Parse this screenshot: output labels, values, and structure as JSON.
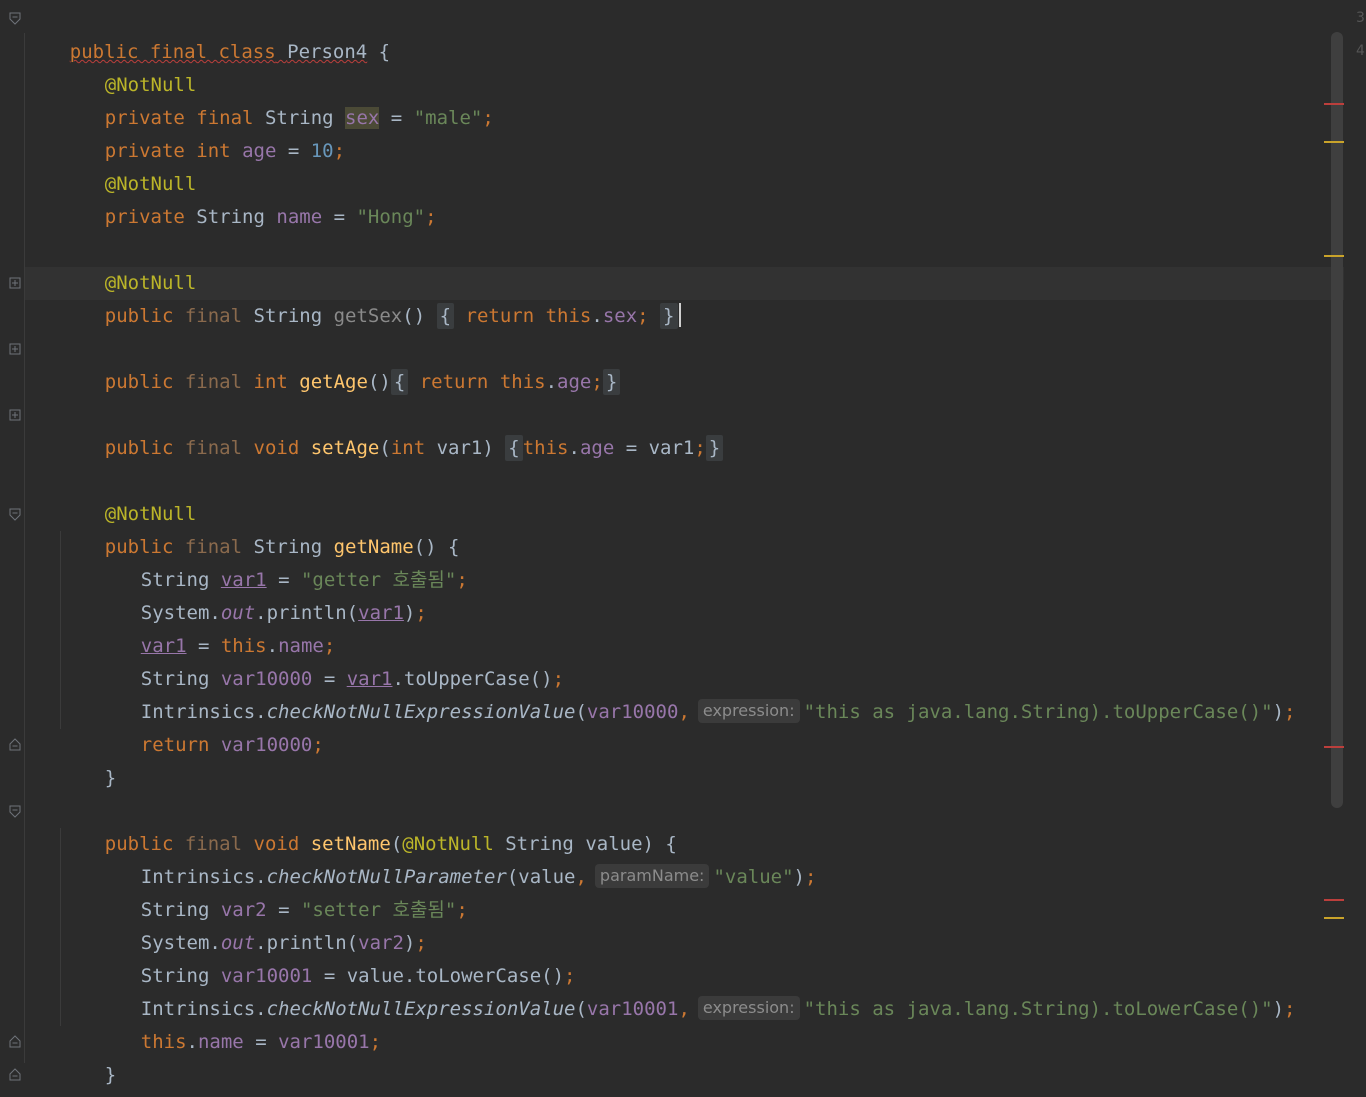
{
  "code": {
    "class_decl": {
      "mods": "public final class",
      "name": "Person4",
      "brace": " {"
    },
    "l2": {
      "ann": "@NotNull"
    },
    "l3": {
      "mods": "private final",
      "type": "String",
      "field": "sex",
      "eq": " = ",
      "str": "\"male\"",
      "semi": ";"
    },
    "l4": {
      "mods": "private",
      "type": "int",
      "field": "age",
      "eq": " = ",
      "num": "10",
      "semi": ";"
    },
    "l5": {
      "ann": "@NotNull"
    },
    "l6": {
      "mods": "private",
      "type": "String",
      "field": "name",
      "eq": " = ",
      "str": "\"Hong\"",
      "semi": ";"
    },
    "l8": {
      "ann": "@NotNull"
    },
    "l9": {
      "mod1": "public",
      "mod2": "final",
      "type": "String",
      "fn": "getSex",
      "parens": "()",
      "ob": "{",
      "ret": "return",
      "this": "this",
      "dot": ".",
      "field": "sex",
      "semi": ";",
      "cb": "}"
    },
    "l11": {
      "mod1": "public",
      "mod2": "final",
      "type": "int",
      "fn": "getAge",
      "parens": "()",
      "ob": "{",
      "ret": "return",
      "this": "this",
      "dot": ".",
      "field": "age",
      "semi": ";",
      "cb": "}"
    },
    "l13": {
      "mod1": "public",
      "mod2": "final",
      "type": "void",
      "fn": "setAge",
      "po": "(",
      "ptype": "int",
      "pname": " var1",
      "pc": ")",
      "ob": "{",
      "this": "this",
      "dot": ".",
      "field": "age",
      "eq": " = var1",
      "semi": ";",
      "cb": "}"
    },
    "l15": {
      "ann": "@NotNull"
    },
    "l16": {
      "mod1": "public",
      "mod2": "final",
      "type": "String",
      "fn": "getName",
      "rest": "() {"
    },
    "l17": {
      "type": "String",
      "var": "var1",
      "eq": " = ",
      "str": "\"getter 호출됨\"",
      "semi": ";"
    },
    "l18": {
      "obj": "System.",
      "static": "out",
      "call": ".println(",
      "var": "var1",
      "end": ")",
      "semi": ";"
    },
    "l19": {
      "var": "var1",
      "eq": " = ",
      "this": "this",
      "dot": ".",
      "field": "name",
      "semi": ";"
    },
    "l20": {
      "type": "String",
      "var": "var10000",
      "eq": " = ",
      "var2": "var1",
      "call": ".toUpperCase()",
      "semi": ";"
    },
    "l21": {
      "obj": "Intrinsics.",
      "method": "checkNotNullExpressionValue",
      "po": "(",
      "var": "var10000",
      "comma": ",",
      "hint": "expression:",
      "str": "\"this as java.lang.String).toUpperCase()\"",
      "end": ")",
      "semi": ";"
    },
    "l22": {
      "ret": "return",
      "var": "var10000",
      "semi": ";"
    },
    "l23": {
      "cb": "}"
    },
    "l25": {
      "mod1": "public",
      "mod2": "final",
      "type": "void",
      "fn": "setName",
      "po": "(",
      "ann": "@NotNull",
      "ptype": "String",
      "pname": " value",
      "rest": ") {"
    },
    "l26": {
      "obj": "Intrinsics.",
      "method": "checkNotNullParameter",
      "po": "(value",
      "comma": ",",
      "hint": "paramName:",
      "str": "\"value\"",
      "end": ")",
      "semi": ";"
    },
    "l27": {
      "type": "String",
      "var": "var2",
      "eq": " = ",
      "str": "\"setter 호출됨\"",
      "semi": ";"
    },
    "l28": {
      "obj": "System.",
      "static": "out",
      "call": ".println(",
      "var": "var2",
      "end": ")",
      "semi": ";"
    },
    "l29": {
      "type": "String",
      "var": "var10001",
      "rest": " = value.toLowerCase()",
      "semi": ";"
    },
    "l30": {
      "obj": "Intrinsics.",
      "method": "checkNotNullExpressionValue",
      "po": "(",
      "var": "var10001",
      "comma": ",",
      "hint": "expression:",
      "str": "\"this as java.lang.String).toLowerCase()\"",
      "end": ")",
      "semi": ";"
    },
    "l31": {
      "this": "this",
      "dot": ".",
      "field": "name",
      "eq": " = ",
      "var": "var10001",
      "semi": ";"
    },
    "l32": {
      "cb": "}"
    },
    "l33": {
      "cb": "}"
    }
  },
  "right_gutter": {
    "n1": "3",
    "n2": "4"
  },
  "colors": {
    "keyword": "#cc7832",
    "annotation": "#bbb529",
    "string": "#6a8759",
    "number": "#6897bb",
    "field": "#9876aa",
    "method": "#ffc66d",
    "background": "#2b2b2b"
  }
}
